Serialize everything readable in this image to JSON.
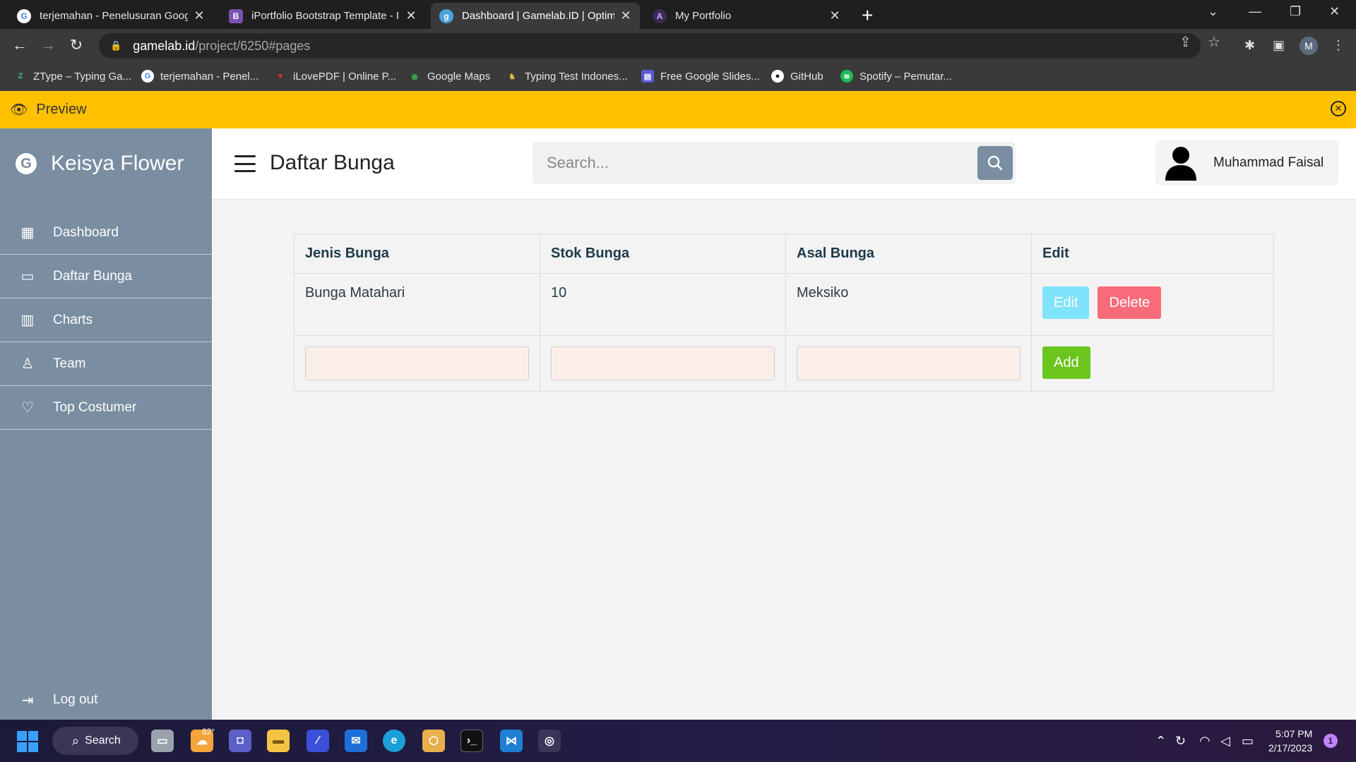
{
  "browser": {
    "tabs": [
      {
        "title": "terjemahan - Penelusuran Google",
        "favicon": "google-icon",
        "color": "#ffffff"
      },
      {
        "title": "iPortfolio Bootstrap Template - Ind",
        "favicon": "bootstrap-icon",
        "color": "#7952b3"
      },
      {
        "title": "Dashboard | Gamelab.ID | Optimi",
        "favicon": "gamelab-icon",
        "color": "#4aa3df"
      },
      {
        "title": "My Portfolio",
        "favicon": "portfolio-icon",
        "color": "#7a5ea8"
      }
    ],
    "address": {
      "host": "gamelab.id",
      "path": "/project/6250#pages"
    },
    "profile_initial": "M",
    "bookmarks": [
      {
        "label": "ZType – Typing Ga...",
        "icon": "ztype-icon"
      },
      {
        "label": "terjemahan - Penel...",
        "icon": "google-icon"
      },
      {
        "label": "iLovePDF | Online P...",
        "icon": "ilovepdf-icon"
      },
      {
        "label": "Google Maps",
        "icon": "maps-icon"
      },
      {
        "label": "Typing Test Indones...",
        "icon": "typing-test-icon"
      },
      {
        "label": "Free Google Slides...",
        "icon": "slides-icon"
      },
      {
        "label": "GitHub",
        "icon": "github-icon"
      },
      {
        "label": "Spotify – Pemutar...",
        "icon": "spotify-icon"
      }
    ]
  },
  "preview_banner": {
    "label": "Preview",
    "color": "#ffc000"
  },
  "sidebar": {
    "brand": "Keisya Flower",
    "color": "#7a8da1",
    "items": [
      {
        "label": "Dashboard",
        "icon": "grid-icon"
      },
      {
        "label": "Daftar Bunga",
        "icon": "archive-icon"
      },
      {
        "label": "Charts",
        "icon": "bar-chart-icon"
      },
      {
        "label": "Team",
        "icon": "person-icon"
      },
      {
        "label": "Top Costumer",
        "icon": "heart-icon"
      }
    ],
    "logout": "Log out"
  },
  "header": {
    "title": "Daftar Bunga",
    "search_placeholder": "Search...",
    "user_name": "Muhammad Faisal"
  },
  "table": {
    "columns": [
      "Jenis Bunga",
      "Stok Bunga",
      "Asal Bunga",
      "Edit"
    ],
    "rows": [
      {
        "jenis": "Bunga Matahari",
        "stok": "10",
        "asal": "Meksiko"
      }
    ],
    "edit_label": "Edit",
    "delete_label": "Delete",
    "add_label": "Add",
    "colors": {
      "edit": "#7fe3fb",
      "delete": "#f96b7a",
      "add": "#6cc51d"
    }
  },
  "taskbar": {
    "search_label": "Search",
    "weather_temp": "82°",
    "time": "5:07 PM",
    "date": "2/17/2023",
    "notifications": "1"
  }
}
